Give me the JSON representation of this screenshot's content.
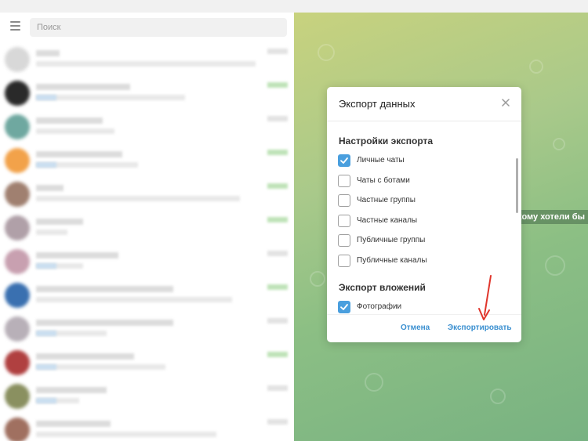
{
  "search": {
    "placeholder": "Поиск"
  },
  "chats": [
    {
      "avatar_color": "#d8d8d8",
      "name_w": 30,
      "msg_w": 280,
      "tag": false,
      "badge": false
    },
    {
      "avatar_color": "#2a2a2a",
      "name_w": 120,
      "msg_w": 190,
      "tag": true,
      "badge": true
    },
    {
      "avatar_color": "#6fa8a0",
      "name_w": 85,
      "msg_w": 100,
      "tag": false,
      "badge": false
    },
    {
      "avatar_color": "#f2a24a",
      "name_w": 110,
      "msg_w": 130,
      "tag": true,
      "badge": true
    },
    {
      "avatar_color": "#a08070",
      "name_w": 35,
      "msg_w": 260,
      "tag": false,
      "badge": true
    },
    {
      "avatar_color": "#b0a0a8",
      "name_w": 60,
      "msg_w": 40,
      "tag": false,
      "badge": true
    },
    {
      "avatar_color": "#c8a0b0",
      "name_w": 105,
      "msg_w": 60,
      "tag": true,
      "badge": false
    },
    {
      "avatar_color": "#3a70b0",
      "name_w": 175,
      "msg_w": 250,
      "tag": false,
      "badge": true
    },
    {
      "avatar_color": "#b8b0b8",
      "name_w": 175,
      "msg_w": 90,
      "tag": true,
      "badge": false
    },
    {
      "avatar_color": "#b04040",
      "name_w": 125,
      "msg_w": 165,
      "tag": true,
      "badge": true
    },
    {
      "avatar_color": "#8a9060",
      "name_w": 90,
      "msg_w": 55,
      "tag": true,
      "badge": false
    },
    {
      "avatar_color": "#a07060",
      "name_w": 95,
      "msg_w": 230,
      "tag": false,
      "badge": false
    }
  ],
  "wallpaper_hint": "те, кому хотели бы",
  "dialog": {
    "title": "Экспорт данных",
    "section_settings": "Настройки экспорта",
    "options": [
      {
        "label": "Личные чаты",
        "checked": true
      },
      {
        "label": "Чаты с ботами",
        "checked": false
      },
      {
        "label": "Частные группы",
        "checked": false
      },
      {
        "label": "Частные каналы",
        "checked": false
      },
      {
        "label": "Публичные группы",
        "checked": false
      },
      {
        "label": "Публичные каналы",
        "checked": false
      }
    ],
    "section_attachments": "Экспорт вложений",
    "attachments": [
      {
        "label": "Фотографии",
        "checked": true
      }
    ],
    "cancel_label": "Отмена",
    "export_label": "Экспортировать"
  },
  "colors": {
    "accent": "#4a9fde",
    "link": "#3a8fd0",
    "annotation_arrow": "#e0352b"
  }
}
